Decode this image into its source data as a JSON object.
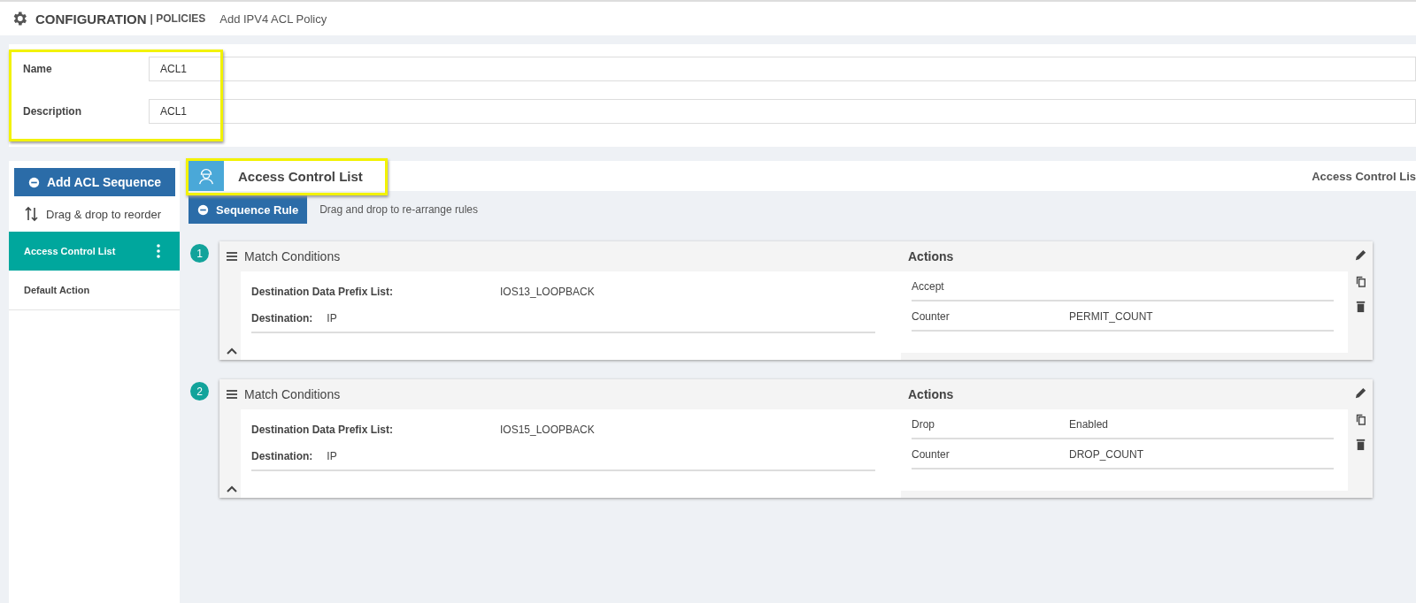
{
  "header": {
    "title": "CONFIGURATION",
    "section": "| POLICIES",
    "subtitle": "Add IPV4 ACL Policy"
  },
  "form": {
    "highlighted": true,
    "fields": [
      {
        "label": "Name",
        "value": "ACL1"
      },
      {
        "label": "Description",
        "value": "ACL1"
      }
    ]
  },
  "sidebar": {
    "add_button": "Add ACL Sequence",
    "hint": "Drag & drop to reorder",
    "items": [
      {
        "label": "Access Control List",
        "selected": true
      },
      {
        "label": "Default Action",
        "selected": false
      }
    ]
  },
  "panel": {
    "title": "Access Control List",
    "highlighted": true,
    "breadcrumb": "Access Control Lis",
    "add_button": "Sequence Rule",
    "hint": "Drag and drop to re-arrange rules"
  },
  "sequences": [
    {
      "number": "1",
      "match_title": "Match Conditions",
      "conditions": [
        {
          "label": "Destination Data Prefix List:",
          "value": "IOS13_LOOPBACK"
        },
        {
          "label": "Destination:",
          "value": "IP"
        }
      ],
      "actions_title": "Actions",
      "actions": [
        {
          "label": "Accept"
        },
        {
          "label": "Counter",
          "value": "PERMIT_COUNT"
        }
      ]
    },
    {
      "number": "2",
      "match_title": "Match Conditions",
      "conditions": [
        {
          "label": "Destination Data Prefix List:",
          "value": "IOS15_LOOPBACK"
        },
        {
          "label": "Destination:",
          "value": "IP"
        }
      ],
      "actions_title": "Actions",
      "actions": [
        {
          "label": "Drop",
          "value": "Enabled"
        },
        {
          "label": "Counter",
          "value": "DROP_COUNT"
        }
      ]
    }
  ]
}
